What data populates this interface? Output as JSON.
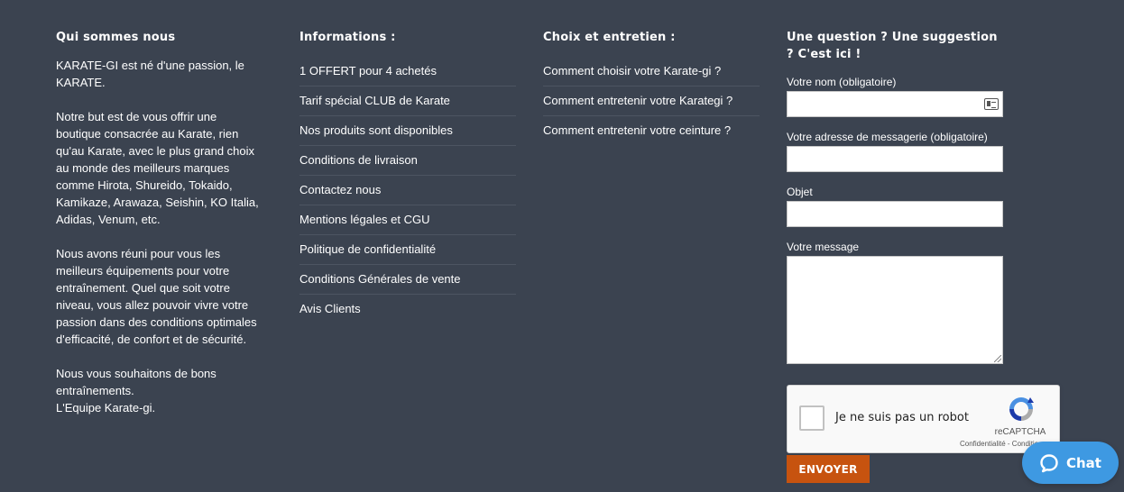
{
  "about": {
    "title": "Qui sommes nous",
    "paragraphs": [
      "KARATE-GI est né d'une passion, le\nKARATE.",
      "Notre but est de vous offrir une\nboutique consacrée au Karate, rien\nqu'au Karate, avec le plus grand choix\nau monde des meilleurs marques\ncomme Hirota, Shureido, Tokaido,\nKamikaze, Arawaza, Seishin, KO Italia,\nAdidas, Venum, etc.",
      "Nous avons réuni pour vous les\nmeilleurs équipements pour votre\nentraînement. Quel que soit votre\nniveau, vous allez pouvoir vivre votre\npassion dans des conditions optimales\nd'efficacité, de confort et de sécurité.",
      "Nous vous souhaitons de bons\nentraînements.\nL'Equipe Karate-gi."
    ]
  },
  "information": {
    "title": "Informations :",
    "links": [
      "1 OFFERT pour 4 achetés",
      "Tarif spécial CLUB de Karate",
      "Nos produits sont disponibles",
      "Conditions de livraison",
      "Contactez nous",
      "Mentions légales et CGU",
      "Politique de confidentialité",
      "Conditions Générales de vente",
      "Avis Clients"
    ]
  },
  "care": {
    "title": "Choix et entretien :",
    "links": [
      "Comment choisir votre Karate-gi ?",
      "Comment entretenir votre Karategi ?",
      "Comment entretenir votre ceinture ?"
    ]
  },
  "contact_form": {
    "title": "Une question ? Une suggestion ? C'est ici !",
    "name_label": "Votre nom (obligatoire)",
    "email_label": "Votre adresse de messagerie (obligatoire)",
    "subject_label": "Objet",
    "message_label": "Votre message",
    "submit_label": "ENVOYER"
  },
  "recaptcha": {
    "label": "Je ne suis pas un robot",
    "brand": "reCAPTCHA",
    "privacy": "Confidentialité - Conditions"
  },
  "chat": {
    "label": "Chat"
  },
  "colors": {
    "background": "#3b4350",
    "submit": "#c7530f",
    "chat": "#3e99e2"
  }
}
